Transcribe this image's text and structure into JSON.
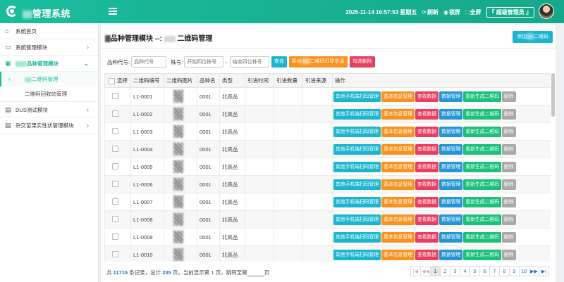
{
  "app": {
    "title_suffix": "管理系统"
  },
  "topbar": {
    "datetime": "2025-11-14 16:57:53 星期五",
    "refresh": "刷新",
    "lock": "锁屏",
    "fullscreen": "全屏",
    "admin": "『 超级管理员 』"
  },
  "sidebar": {
    "items": [
      {
        "label": "系统首页",
        "icon": "home-icon"
      },
      {
        "label": "系统管理模块",
        "icon": "monitor-icon"
      },
      {
        "label": "品种管理模块",
        "icon": "image-icon"
      },
      {
        "label": "DUS测试模块",
        "icon": "document-icon"
      },
      {
        "label": "杂交苗果实性状管理模块",
        "icon": "document-icon"
      }
    ],
    "subitems": [
      {
        "label": "二维码管理"
      },
      {
        "label": "二维码回收站管理"
      }
    ]
  },
  "page": {
    "title_part1": "品种管理模块 --:",
    "title_part2": "二维码管理",
    "add_button": "添加",
    "add_button_suffix": "二维码"
  },
  "filter": {
    "variety_label": "品种代号:",
    "variety_placeholder": "品种代号",
    "plant_label": "株号:",
    "start_placeholder": "开始四位株号",
    "dash": "-",
    "end_placeholder": "结束四位株号",
    "query": "查询",
    "export_prefix": "导出",
    "export_suffix": "二维码打印信息",
    "batch_delete": "勾选删除"
  },
  "table": {
    "headers": [
      "选择",
      "二维码编号",
      "二维码图片",
      "品种名",
      "类型",
      "引进时间",
      "引进数量",
      "引进来源",
      "操作"
    ],
    "rows": [
      {
        "code": "L1-0001",
        "variety": "0001",
        "type": "北高丛"
      },
      {
        "code": "L1-0002",
        "variety": "0001",
        "type": "北高丛"
      },
      {
        "code": "L1-0003",
        "variety": "0001",
        "type": "北高丛"
      },
      {
        "code": "L1-0004",
        "variety": "0001",
        "type": "北高丛"
      },
      {
        "code": "L1-0005",
        "variety": "0001",
        "type": "北高丛"
      },
      {
        "code": "L1-0006",
        "variety": "0001",
        "type": "北高丛"
      },
      {
        "code": "L1-0007",
        "variety": "0001",
        "type": "北高丛"
      },
      {
        "code": "L1-0008",
        "variety": "0001",
        "type": "北高丛"
      },
      {
        "code": "L1-0009",
        "variety": "0001",
        "type": "北高丛"
      },
      {
        "code": "L1-0010",
        "variety": "0001",
        "type": "北高丛"
      }
    ],
    "actions": [
      {
        "label": "其他手机端扫码管理",
        "color": "#1cb5d0"
      },
      {
        "label": "基本信息管理",
        "color": "#f7931e"
      },
      {
        "label": "查看数据",
        "color": "#e83e5f"
      },
      {
        "label": "数据管理",
        "color": "#2596d4"
      },
      {
        "label": "重新生成二维码",
        "color": "#1bc17b"
      },
      {
        "label": "删除",
        "color": "#a9a9a9"
      }
    ]
  },
  "footer": {
    "prefix": "共",
    "total": "11715",
    "records": "条记录，总计",
    "pages": "235",
    "pages_text": "页，当前显示第",
    "current": "1",
    "current_text": "页，跳转至第",
    "suffix": "页"
  },
  "pager": {
    "pages": [
      "1",
      "2",
      "3",
      "4",
      "5",
      "6",
      "7",
      "8",
      "9",
      "10"
    ],
    "current": "1"
  },
  "colors": {
    "brand": "#1abc9c",
    "link": "#2574b8"
  }
}
